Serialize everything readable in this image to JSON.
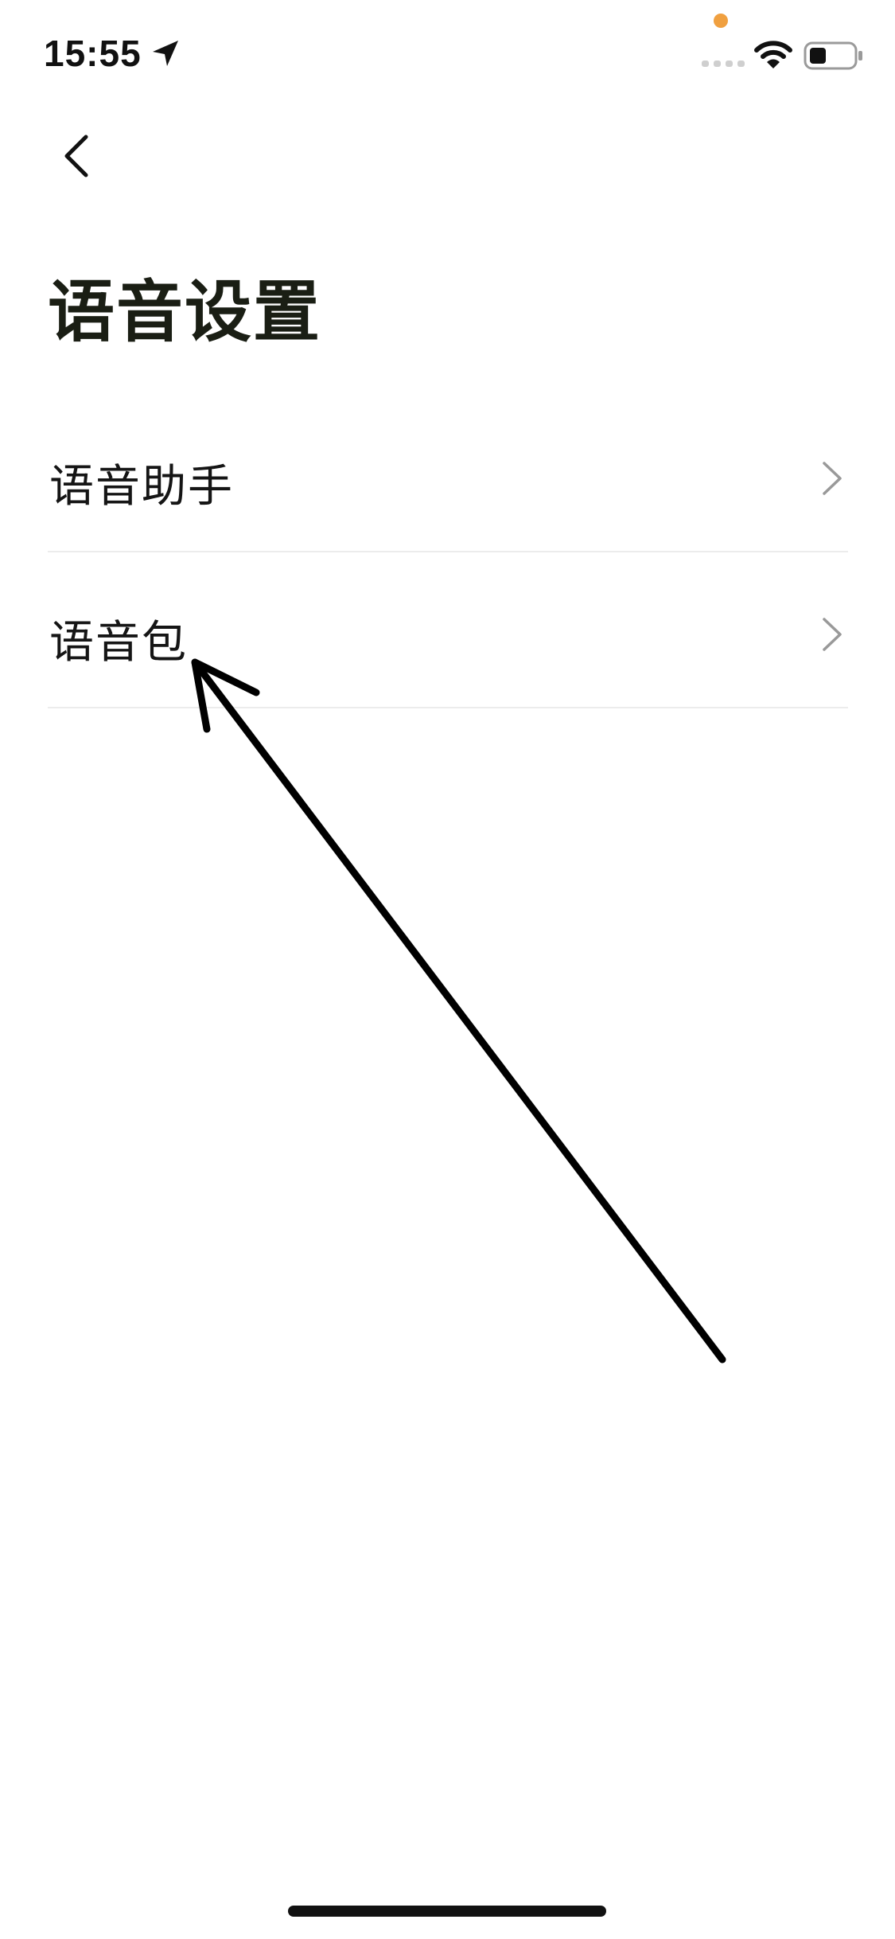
{
  "status_bar": {
    "time": "15:55",
    "mic_dot_color": "#f0a040"
  },
  "header": {
    "back_icon": "chevron-left-icon",
    "title": "语音设置"
  },
  "menu": {
    "items": [
      {
        "label": "语音助手",
        "icon": "chevron-right-icon"
      },
      {
        "label": "语音包",
        "icon": "chevron-right-icon"
      }
    ]
  },
  "colors": {
    "background": "#ffffff",
    "title": "#1a1e14",
    "divider": "#ececec",
    "chevron": "#999999",
    "annotation": "#000000"
  }
}
